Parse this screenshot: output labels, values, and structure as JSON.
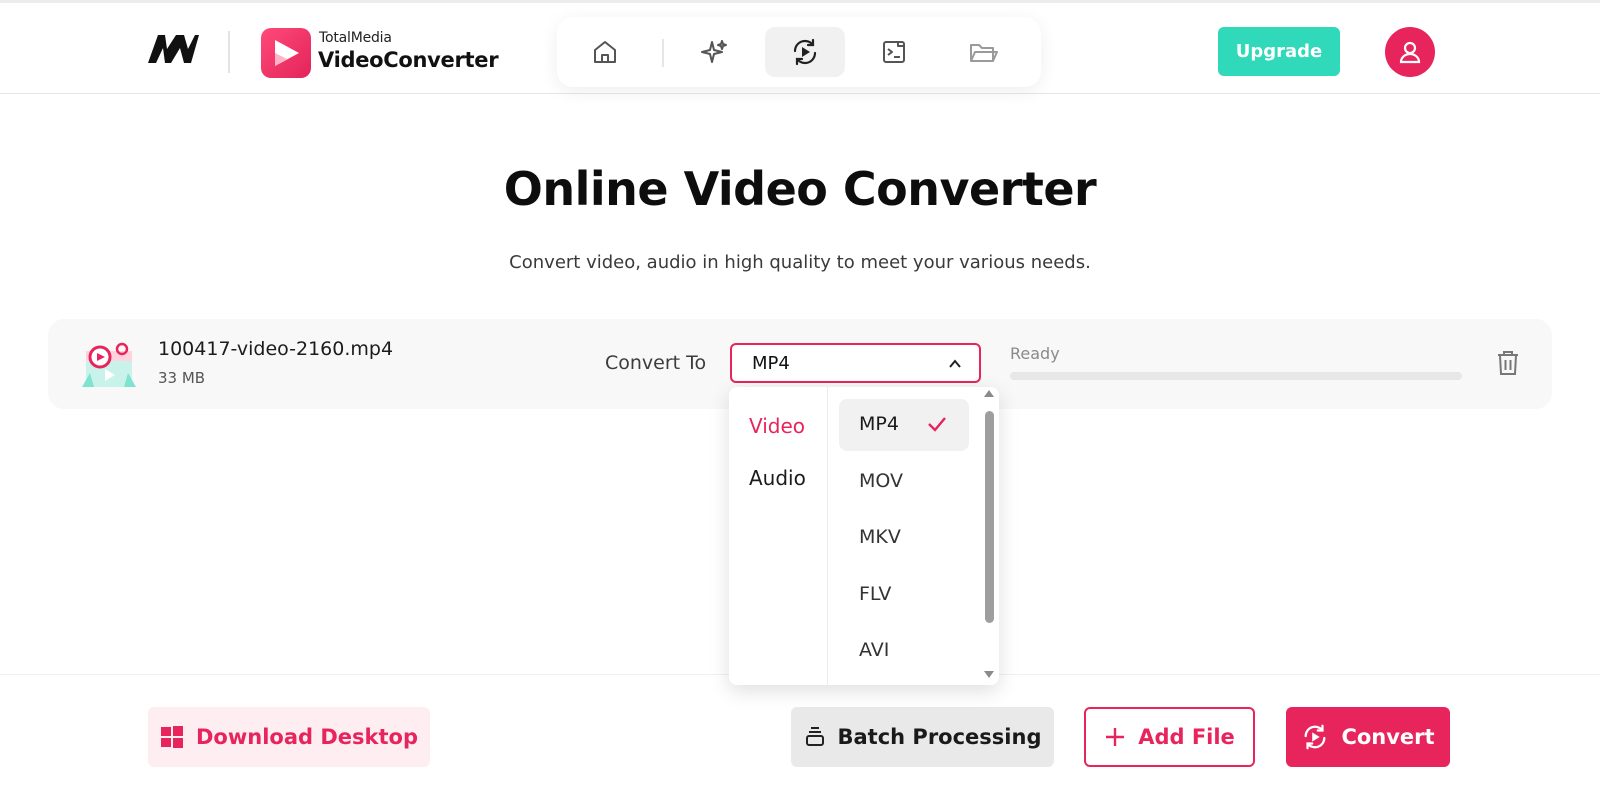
{
  "header": {
    "brand_top": "TotalMedia",
    "brand_main": "VideoConverter",
    "nav_icons": [
      "home-icon",
      "sparkle-icon",
      "convert-icon",
      "image-edit-icon",
      "folder-icon"
    ],
    "upgrade_label": "Upgrade",
    "accent_color": "#e8245c",
    "upgrade_color": "#2fd9b9"
  },
  "main": {
    "title": "Online Video Converter",
    "subtitle": "Convert video, audio in high quality to meet your various needs."
  },
  "file": {
    "name": "100417-video-2160.mp4",
    "size": "33 MB",
    "convert_to_label": "Convert To",
    "selected_format": "MP4",
    "status": "Ready",
    "progress": 0
  },
  "dropdown": {
    "categories": [
      "Video",
      "Audio"
    ],
    "active_category": "Video",
    "options": [
      "MP4",
      "MOV",
      "MKV",
      "FLV",
      "AVI"
    ],
    "selected_option": "MP4"
  },
  "footer": {
    "download_label": "Download Desktop",
    "batch_label": "Batch Processing",
    "add_label": "Add File",
    "convert_label": "Convert"
  }
}
